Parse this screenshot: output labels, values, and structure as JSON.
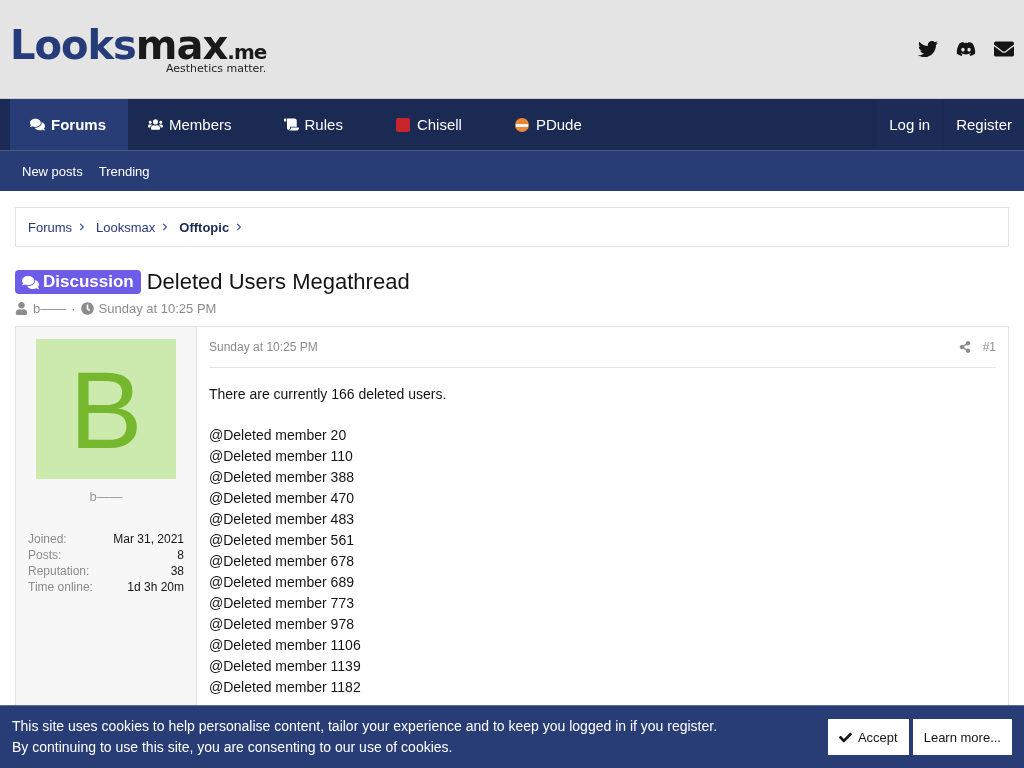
{
  "logo": {
    "brand_a": "Looks",
    "brand_b": "max",
    "suffix": ".me",
    "tagline": "Aesthetics matter."
  },
  "header_icons": [
    {
      "kind": "twitter"
    },
    {
      "kind": "discord"
    },
    {
      "kind": "mail"
    }
  ],
  "nav": {
    "items": [
      {
        "label": "Forums",
        "kind": "comments",
        "selected": true
      },
      {
        "label": "Members",
        "kind": "users",
        "selected": false
      },
      {
        "label": "Rules",
        "kind": "scroll",
        "selected": false
      },
      {
        "label": "Chisell",
        "kind": "chisell",
        "selected": false
      },
      {
        "label": "PDude",
        "kind": "pdude",
        "selected": false
      }
    ],
    "account": [
      "Log in",
      "Register"
    ]
  },
  "subnav": [
    "New posts",
    "Trending"
  ],
  "breadcrumbs": [
    {
      "label": "Forums",
      "current": false
    },
    {
      "label": "Looksmax",
      "current": false
    },
    {
      "label": "Offtopic",
      "current": true
    }
  ],
  "thread": {
    "prefix": "Discussion",
    "title": "Deleted Users Megathread",
    "author": "b——",
    "separator": "·",
    "date": "Sunday at 10:25 PM"
  },
  "post": {
    "avatar_letter": "B",
    "username": "b——",
    "stats": [
      {
        "label": "Joined:",
        "value": "Mar 31, 2021"
      },
      {
        "label": "Posts:",
        "value": "8"
      },
      {
        "label": "Reputation:",
        "value": "38"
      },
      {
        "label": "Time online:",
        "value": "1d 3h 20m"
      }
    ],
    "date": "Sunday at 10:25 PM",
    "number": "#1",
    "intro": "There are currently 166 deleted users.",
    "mentions": [
      "@Deleted member 20",
      "@Deleted member 110",
      "@Deleted member 388",
      "@Deleted member 470",
      "@Deleted member 483",
      "@Deleted member 561",
      "@Deleted member 678",
      "@Deleted member 689",
      "@Deleted member 773",
      "@Deleted member 978",
      "@Deleted member 1106",
      "@Deleted member 1139",
      "@Deleted member 1182"
    ]
  },
  "cookie": {
    "lines": [
      "This site uses cookies to help personalise content, tailor your experience and to keep you logged in if you register.",
      "By continuing to use this site, you are consenting to our use of cookies."
    ],
    "accept": "Accept",
    "learn": "Learn more..."
  }
}
